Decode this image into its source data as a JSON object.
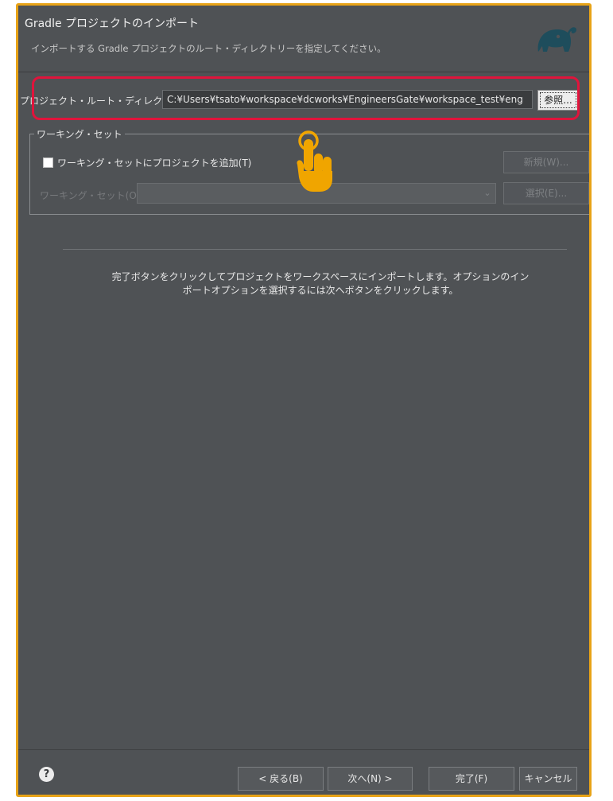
{
  "dialog": {
    "title": "Gradle プロジェクトのインポート",
    "subtitle": "インポートする Gradle プロジェクトのルート・ディレクトリーを指定してください。"
  },
  "root": {
    "label": "プロジェクト・ルート・ディレクトリー",
    "value": "C:¥Users¥tsato¥workspace¥dcworks¥EngineersGate¥workspace_test¥eng",
    "browse_label": "参照..."
  },
  "working_set": {
    "group_label": "ワーキング・セット",
    "checkbox_label": "ワーキング・セットにプロジェクトを追加(T)",
    "checked": false,
    "new_label": "新規(W)...",
    "set_label": "ワーキング・セット(O)",
    "select_label": "選択(E)..."
  },
  "message": {
    "line1": "完了ボタンをクリックしてプロジェクトをワークスペースにインポートします。オプションのイン",
    "line2": "ポートオプションを選択するには次へボタンをクリックします。"
  },
  "footer": {
    "help_glyph": "?",
    "back_label": "< 戻る(B)",
    "next_label": "次へ(N) >",
    "finish_label": "完了(F)",
    "cancel_label": "キャンセル"
  },
  "colors": {
    "frame_border": "#E8A317",
    "highlight": "#E0143C",
    "background": "#4F5255",
    "cursor": "#F0A500",
    "logo": "#1E4D5C"
  },
  "icons": {
    "logo": "gradle-elephant-icon",
    "help": "help-icon",
    "cursor": "pointing-hand-icon"
  }
}
